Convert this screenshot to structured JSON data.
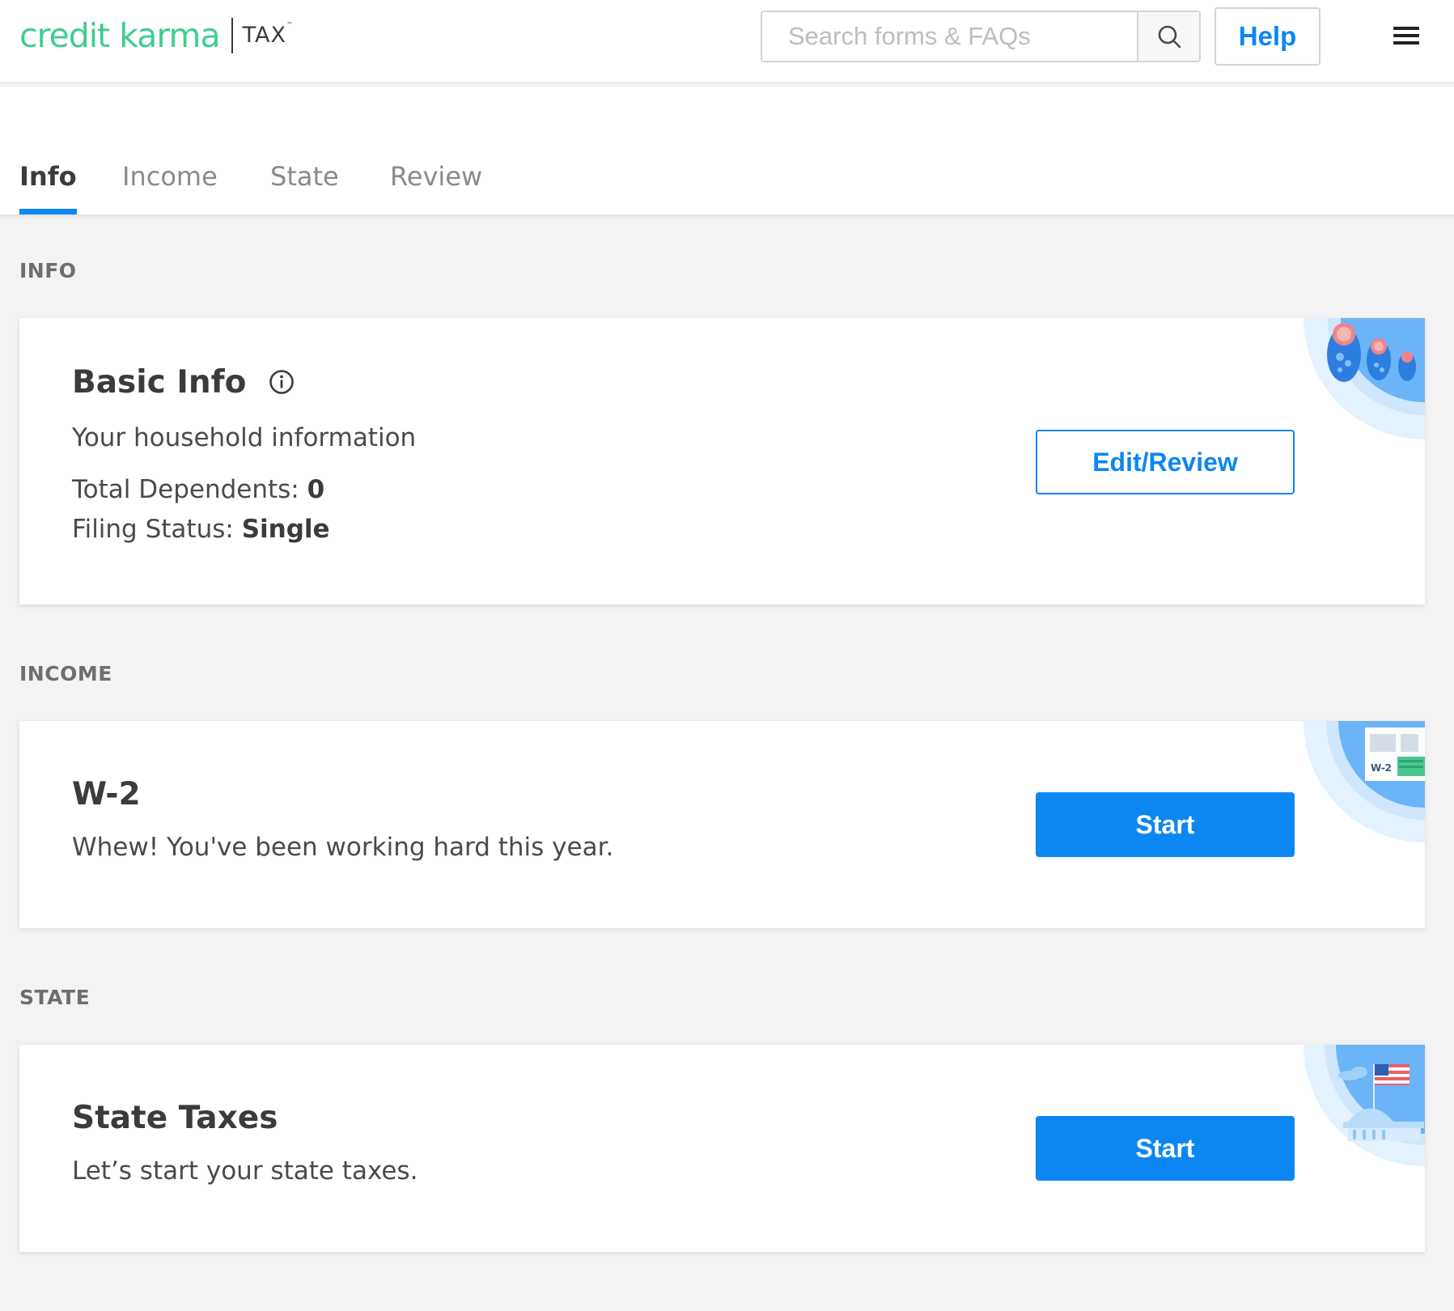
{
  "header": {
    "logo_brand": "credit karma",
    "logo_product": "TAX",
    "logo_mark": "™",
    "search_placeholder": "Search forms & FAQs",
    "search_icon": "search-icon",
    "help_label": "Help",
    "menu_icon": "hamburger-menu-icon"
  },
  "tabs": [
    {
      "label": "Info",
      "active": true
    },
    {
      "label": "Income",
      "active": false
    },
    {
      "label": "State",
      "active": false
    },
    {
      "label": "Review",
      "active": false
    }
  ],
  "sections": {
    "info": {
      "label": "INFO",
      "card": {
        "title": "Basic Info",
        "subtitle": "Your household information",
        "dependents_label": "Total Dependents: ",
        "dependents_value": "0",
        "filing_label": "Filing Status: ",
        "filing_value": "Single",
        "button_label": "Edit/Review",
        "illustration": "nesting-dolls-icon"
      }
    },
    "income": {
      "label": "INCOME",
      "card": {
        "title": "W-2",
        "subtitle": "Whew! You've been working hard this year.",
        "button_label": "Start",
        "illustration_text": "W-2",
        "illustration": "w2-form-icon"
      }
    },
    "state": {
      "label": "STATE",
      "card": {
        "title": "State Taxes",
        "subtitle": "Let’s start your state taxes.",
        "button_label": "Start",
        "illustration": "capitol-flag-icon"
      }
    }
  },
  "colors": {
    "brand_green": "#3ecf8e",
    "accent_blue": "#0c87f2",
    "background": "#f3f3f3"
  }
}
